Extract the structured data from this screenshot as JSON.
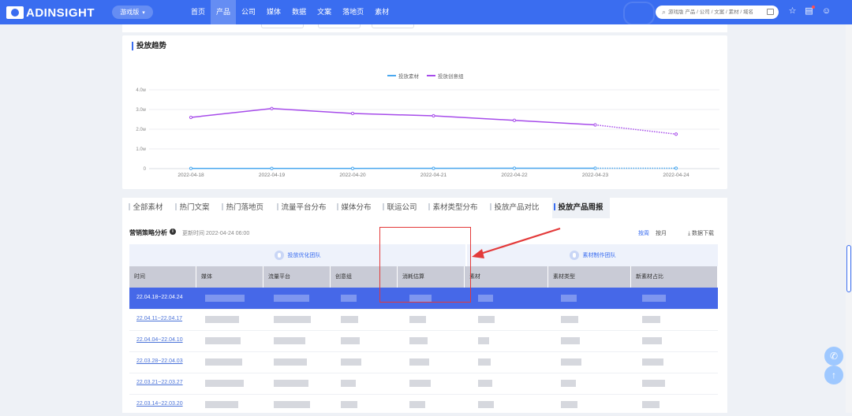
{
  "brand": {
    "logo_text": "ADINSIGHT",
    "version_label": "游戏版"
  },
  "nav": {
    "items": [
      "首页",
      "产品",
      "公司",
      "媒体",
      "数据",
      "文案",
      "落地页",
      "素材"
    ],
    "active_index": 1
  },
  "search": {
    "placeholder": "游戏版 产品 / 公司 / 文案 / 素材 / 域名"
  },
  "icons": {
    "search": "search-icon",
    "camera": "camera-icon",
    "star": "star-icon",
    "message": "message-icon",
    "user": "user-icon",
    "wechat": "wechat-icon",
    "back_top": "back-to-top-icon",
    "download": "download-icon",
    "info": "info-icon"
  },
  "trend": {
    "title": "投放趋势"
  },
  "chart_data": {
    "type": "line",
    "title": "投放趋势",
    "x": [
      "2022-04-18",
      "2022-04-19",
      "2022-04-20",
      "2022-04-21",
      "2022-04-22",
      "2022-04-23",
      "2022-04-24"
    ],
    "y_ticks": [
      "0",
      "1.0w",
      "2.0w",
      "3.0w",
      "4.0w"
    ],
    "ylim": [
      0,
      40000
    ],
    "grid": true,
    "legend_position": "top-center",
    "series": [
      {
        "name": "投放素材",
        "color": "#4aa8ef",
        "values": [
          100,
          100,
          100,
          150,
          200,
          200,
          200
        ],
        "dashed_from_index": 5
      },
      {
        "name": "投放创意组",
        "color": "#a64bea",
        "values": [
          26000,
          30500,
          28000,
          26800,
          24500,
          22200,
          17500
        ],
        "dashed_from_index": 5
      }
    ]
  },
  "tabs": {
    "items": [
      "全部素材",
      "热门文案",
      "热门落地页",
      "流量平台分布",
      "媒体分布",
      "联运公司",
      "素材类型分布",
      "投放产品对比",
      "投放产品周报"
    ],
    "active_index": 8
  },
  "analysis": {
    "title": "营销策略分析",
    "info_glyph": "i",
    "update_time": "更新时间 2022-04-24 06:00",
    "options": [
      "按周",
      "按月"
    ],
    "active_option": 0,
    "download_label": "数据下载",
    "groups": [
      "投放优化团队",
      "素材制作团队"
    ],
    "columns": [
      "时间",
      "媒体",
      "流量平台",
      "创意组",
      "消耗估算",
      "素材",
      "素材类型",
      "新素材占比"
    ],
    "rows": [
      "22.04.18~22.04.24",
      "22.04.11~22.04.17",
      "22.04.04~22.04.10",
      "22.03.28~22.04.03",
      "22.03.21~22.03.27",
      "22.03.14~22.03.20"
    ],
    "selected_row": 0
  },
  "float_buttons": {
    "wechat_glyph": "✆",
    "top_glyph": "↑"
  }
}
